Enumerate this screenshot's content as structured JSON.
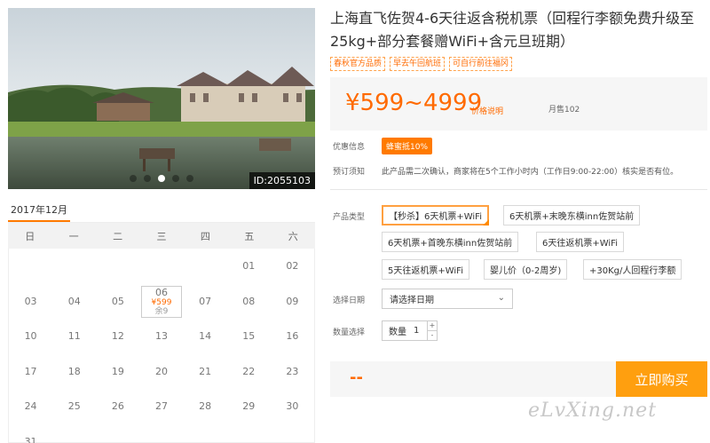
{
  "photo": {
    "id_tag": "ID:2055103",
    "dots": 5,
    "active_dot": 3
  },
  "calendar": {
    "month": "2017年12月",
    "weekdays": [
      "日",
      "一",
      "二",
      "三",
      "四",
      "五",
      "六"
    ],
    "days": [
      "",
      "",
      "",
      "",
      "",
      "01",
      "02",
      "03",
      "04",
      "05",
      "06",
      "07",
      "08",
      "09",
      "10",
      "11",
      "12",
      "13",
      "14",
      "15",
      "16",
      "17",
      "18",
      "19",
      "20",
      "21",
      "22",
      "23",
      "24",
      "25",
      "26",
      "27",
      "28",
      "29",
      "30",
      "31",
      "",
      "",
      "",
      "",
      "",
      ""
    ],
    "selected": {
      "day": "06",
      "price": "¥599",
      "stock": "余9"
    }
  },
  "product": {
    "title": "上海直飞佐贺4-6天往返含税机票（回程行李额免费升级至25kg+部分套餐赠WiFi+含元旦班期）",
    "tags": [
      "春秋官方品质",
      "早去午回航班",
      "可自行前往福冈"
    ],
    "price_range": "¥599~4999",
    "price_explain": "价格说明",
    "monthly_sold": "月售102",
    "discount_label": "优惠信息",
    "discount_badge": "蜂蜜抵10%",
    "booking_label": "预订须知",
    "booking_text": "此产品需二次确认，商家将在5个工作小时内（工作日9:00-22:00）核实是否有位。",
    "type_label": "产品类型",
    "options": [
      "【秒杀】6天机票+WiFi",
      "6天机票+末晚东横inn佐贺站前",
      "6天机票+首晚东横inn佐贺站前",
      "6天往返机票+WiFi",
      "5天往返机票+WiFi",
      "婴儿价（0-2周岁)",
      "+30Kg/人回程行李额"
    ],
    "date_label": "选择日期",
    "date_placeholder": "请选择日期",
    "qty_label": "数量选择",
    "qty_text": "数量",
    "qty_value": "1",
    "total": "--",
    "buy_label": "立即购买"
  },
  "watermark": "eLvXing.net",
  "colors": {
    "accent": "#ff6a00",
    "buy_button": "#ff9f0f"
  }
}
